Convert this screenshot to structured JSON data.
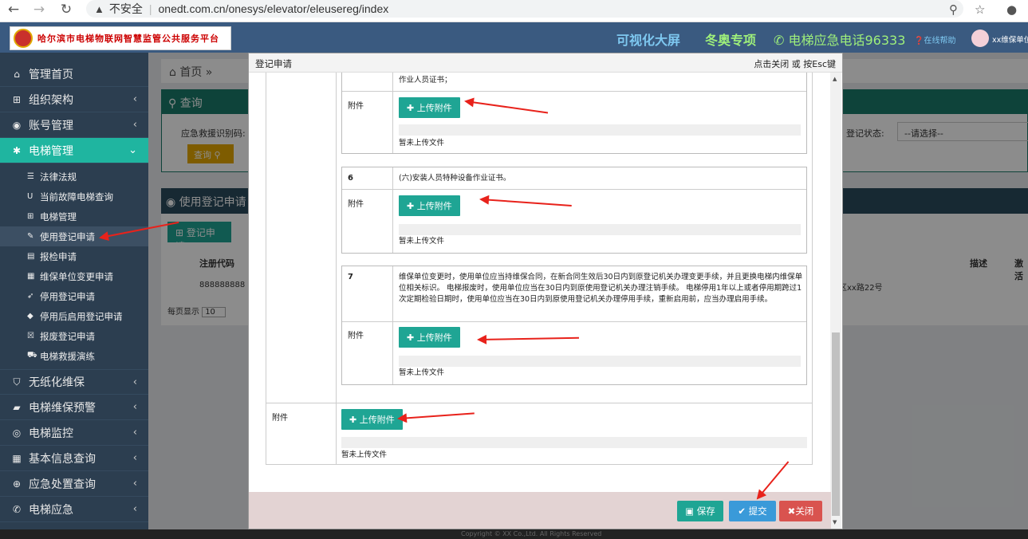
{
  "browser": {
    "security": "不安全",
    "url": "onedt.com.cn/onesys/elevator/eleusereg/index"
  },
  "header": {
    "logo_text": "哈尔滨市电梯物联网智慧监管公共服务平台",
    "screen": "可视化大屏",
    "olympics": "冬奥专项",
    "hotline": "电梯应急电话96333",
    "help": "在线帮助",
    "user": "xx维保单位"
  },
  "sidebar": {
    "items": [
      {
        "label": "管理首页"
      },
      {
        "label": "组织架构"
      },
      {
        "label": "账号管理"
      },
      {
        "label": "电梯管理"
      }
    ],
    "sub": [
      {
        "label": "法律法规"
      },
      {
        "label": "当前故障电梯查询"
      },
      {
        "label": "电梯管理"
      },
      {
        "label": "使用登记申请"
      },
      {
        "label": "报检申请"
      },
      {
        "label": "维保单位变更申请"
      },
      {
        "label": "停用登记申请"
      },
      {
        "label": "停用后启用登记申请"
      },
      {
        "label": "报废登记申请"
      },
      {
        "label": "电梯救援演练"
      }
    ],
    "bottom": [
      {
        "label": "无纸化维保"
      },
      {
        "label": "电梯维保预警"
      },
      {
        "label": "电梯监控"
      },
      {
        "label": "基本信息查询"
      },
      {
        "label": "应急处置查询"
      },
      {
        "label": "电梯应急"
      }
    ]
  },
  "background": {
    "breadcrumb_home": "首页",
    "query_title": "查询",
    "field_label": "应急救援识别码:",
    "query_btn": "查询",
    "status_label": "登记状态:",
    "status_placeholder": "--请选择--",
    "list_title": "使用登记申请",
    "reg_btn": "登记申请",
    "col_code": "注册代码",
    "col_desc": "描述",
    "col_act": "激活",
    "cell_code": "888888888",
    "cell_addr": "区xx路22号",
    "page_show": "每页显示",
    "page_size": "10"
  },
  "modal": {
    "title": "登记申请",
    "close_hint": "点击关闭 或 按Esc键",
    "top_text": "作业人员证书；",
    "attach_label": "附件",
    "upload_label": "上传附件",
    "no_file": "暂未上传文件",
    "item6_num": "6",
    "item6_text": "(六)安装人员特种设备作业证书。",
    "item7_num": "7",
    "item7_text": "维保单位变更时，使用单位应当持维保合同，在新合同生效后30日内到原登记机关办理变更手续，并且更换电梯内维保单位相关标识。 电梯报废时，使用单位应当在30日内到原使用登记机关办理注销手续。 电梯停用1年以上或者停用期跨过1次定期检验日期时，使用单位应当在30日内到原使用登记机关办理停用手续，重新启用前，应当办理启用手续。",
    "save": "保存",
    "submit": "提交",
    "close": "关闭"
  },
  "footer": {
    "copyright": "Copyright © XX Co.,Ltd. All Rights Reserved"
  }
}
